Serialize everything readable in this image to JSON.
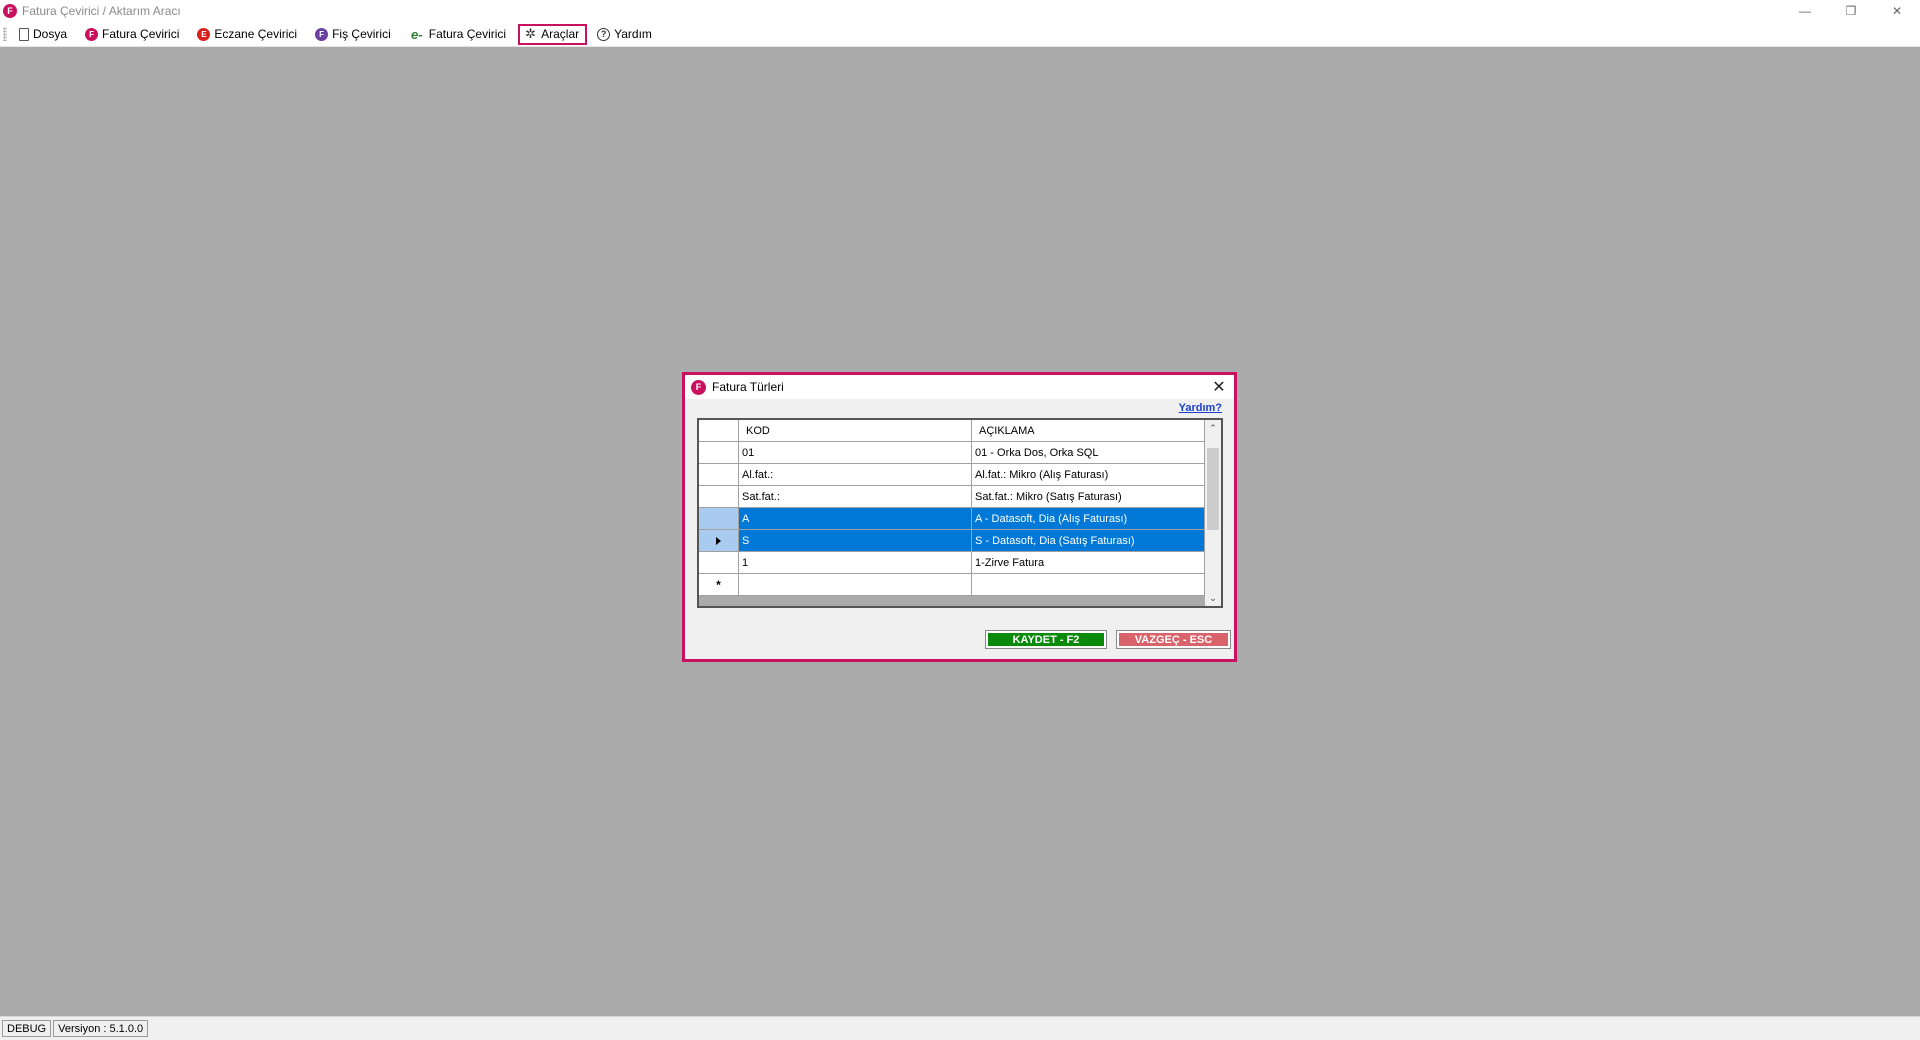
{
  "window": {
    "title": "Fatura Çevirici / Aktarım Aracı",
    "app_logo_letter": "F",
    "controls": {
      "minimize": "—",
      "restore": "❐",
      "close": "✕"
    }
  },
  "menubar": {
    "items": [
      {
        "label": "Dosya",
        "icon": "document-icon"
      },
      {
        "label": "Fatura Çevirici",
        "icon": "fatura-logo-icon",
        "icon_letter": "F"
      },
      {
        "label": "Eczane Çevirici",
        "icon": "eczane-logo-icon",
        "icon_letter": "E"
      },
      {
        "label": "Fiş Çevirici",
        "icon": "fis-logo-icon",
        "icon_letter": "F"
      },
      {
        "label": "Fatura Çevirici",
        "icon": "e-fatura-icon",
        "icon_glyph": "e-"
      },
      {
        "label": "Araçlar",
        "icon": "tools-icon",
        "icon_glyph": "✲",
        "active": true
      },
      {
        "label": "Yardım",
        "icon": "help-icon",
        "icon_glyph": "?"
      }
    ]
  },
  "dialog": {
    "title": "Fatura Türleri",
    "logo_letter": "F",
    "close_glyph": "✕",
    "help_link": "Yardım?",
    "grid": {
      "columns": [
        "KOD",
        "AÇIKLAMA"
      ],
      "rows": [
        {
          "kod": "01",
          "aciklama": "01 - Orka Dos, Orka SQL",
          "selected": false
        },
        {
          "kod": "Al.fat.:",
          "aciklama": "Al.fat.: Mikro (Alış Faturası)",
          "selected": false
        },
        {
          "kod": "Sat.fat.:",
          "aciklama": "Sat.fat.: Mikro (Satış Faturası)",
          "selected": false
        },
        {
          "kod": "A",
          "aciklama": "A - Datasoft, Dia (Alış Faturası)",
          "selected": true
        },
        {
          "kod": "S",
          "aciklama": "S - Datasoft, Dia (Satış Faturası)",
          "selected": true,
          "current": true
        },
        {
          "kod": "1",
          "aciklama": "1-Zirve Fatura",
          "selected": false
        }
      ],
      "new_row_marker": "*",
      "scroll_up_glyph": "⌃",
      "scroll_down_glyph": "⌄"
    },
    "buttons": {
      "save_label": "KAYDET - F2",
      "cancel_label": "VAZGEÇ - ESC"
    }
  },
  "statusbar": {
    "mode": "DEBUG",
    "version": "Versiyon : 5.1.0.0"
  },
  "colors": {
    "accent": "#c8115f",
    "selection": "#0078d7",
    "save_button": "#0a8a0a",
    "cancel_button": "#d9636b"
  }
}
